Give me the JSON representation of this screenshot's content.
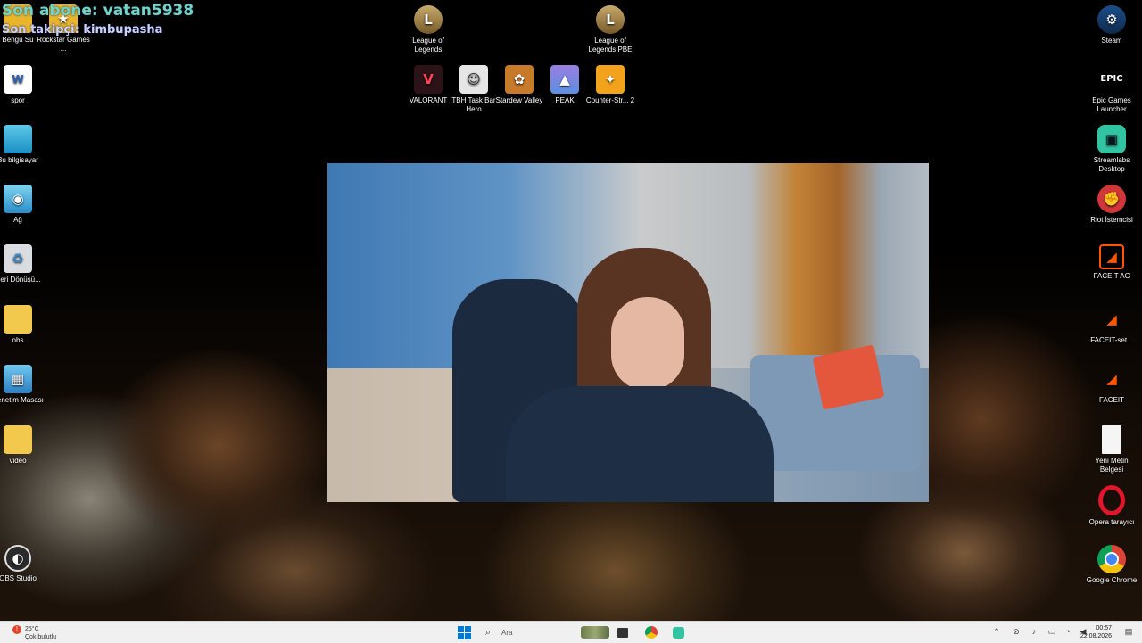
{
  "stream_overlay": {
    "last_subscriber": "Son abone: vatan5938",
    "last_follower": "Son takipçi: kimbupasha"
  },
  "desktop_icons_left": [
    {
      "label": "Bengü Su",
      "icon": "folder-icon"
    },
    {
      "label": "Rockstar Games ...",
      "icon": "rockstar-icon"
    },
    {
      "label": "spor",
      "icon": "word-document-icon"
    },
    {
      "label": "Bu bilgisayar",
      "icon": "monitor-icon"
    },
    {
      "label": "Ağ",
      "icon": "network-icon"
    },
    {
      "label": "Geri Dönüşü...",
      "icon": "recycle-bin-icon"
    },
    {
      "label": "obs",
      "icon": "folder-icon"
    },
    {
      "label": "Denetim Masası",
      "icon": "control-panel-icon"
    },
    {
      "label": "video",
      "icon": "folder-icon"
    },
    {
      "label": "OBS Studio",
      "icon": "obs-icon"
    }
  ],
  "desktop_icons_top": [
    {
      "label": "League of Legends",
      "icon": "league-icon"
    },
    {
      "label": "League of Legends PBE",
      "icon": "league-pbe-icon"
    },
    {
      "label": "VALORANT",
      "icon": "valorant-icon"
    },
    {
      "label": "TBH Task Bar Hero",
      "icon": "tbh-icon"
    },
    {
      "label": "Stardew Valley",
      "icon": "stardew-icon"
    },
    {
      "label": "PEAK",
      "icon": "peak-icon"
    },
    {
      "label": "Counter-Str... 2",
      "icon": "counter-strike-icon"
    }
  ],
  "desktop_icons_right": [
    {
      "label": "Steam",
      "icon": "steam-icon"
    },
    {
      "label": "Epic Games Launcher",
      "icon": "epic-games-icon",
      "glyph": "EPIC"
    },
    {
      "label": "Streamlabs Desktop",
      "icon": "streamlabs-icon"
    },
    {
      "label": "Riot İstemcisi",
      "icon": "riot-icon"
    },
    {
      "label": "FACEIT AC",
      "icon": "faceit-ac-icon"
    },
    {
      "label": "FACEIT-set...",
      "icon": "faceit-setup-icon"
    },
    {
      "label": "FACEIT",
      "icon": "faceit-icon"
    },
    {
      "label": "Yeni Metin Belgesi",
      "icon": "text-document-icon"
    },
    {
      "label": "Opera tarayıcı",
      "icon": "opera-icon"
    },
    {
      "label": "Google Chrome",
      "icon": "chrome-icon"
    }
  ],
  "taskbar": {
    "weather_temp": "25°C",
    "weather_desc": "Çok bulutlu",
    "weather_badge": "!",
    "search_placeholder": "Ara",
    "clock_time": "00:57",
    "clock_date": "22.08.2026",
    "pinned": [
      "start-icon",
      "search-icon",
      "widget-icon",
      "file-explorer-icon",
      "chrome-icon",
      "streamlabs-icon"
    ]
  },
  "colors": {
    "overlay_sub": "#6fd6c6",
    "overlay_follow": "#c7d2ff",
    "taskbar_bg": "#f0f0f0",
    "windows_blue": "#0078d4"
  }
}
